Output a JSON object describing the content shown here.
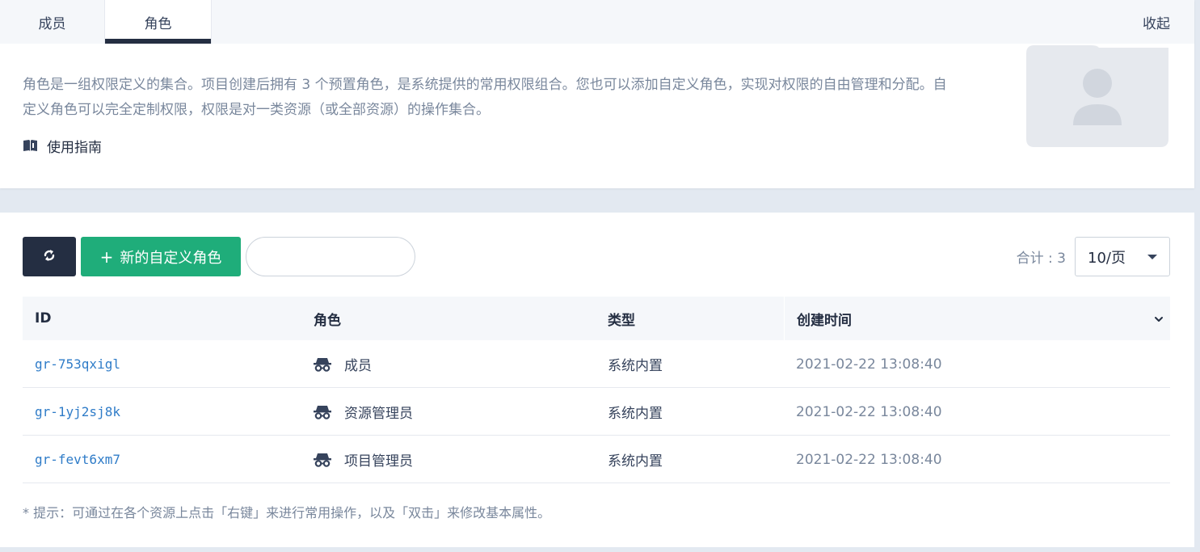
{
  "tabs": [
    {
      "label": "成员",
      "active": false
    },
    {
      "label": "角色",
      "active": true
    }
  ],
  "collapse_label": "收起",
  "description": "角色是一组权限定义的集合。项目创建后拥有 3 个预置角色，是系统提供的常用权限组合。您也可以添加自定义角色，实现对权限的自由管理和分配。自定义角色可以完全定制权限，权限是对一类资源（或全部资源）的操作集合。",
  "guide": {
    "label": "使用指南",
    "icon": "book-icon"
  },
  "toolbar": {
    "refresh_icon": "refresh-icon",
    "create_label": "新的自定义角色",
    "create_icon": "plus-icon",
    "search_placeholder": "",
    "total_label": "合计 : 3",
    "page_size": "10/页"
  },
  "table": {
    "columns": [
      "ID",
      "角色",
      "类型",
      "创建时间"
    ],
    "rows": [
      {
        "id": "gr-753qxigl",
        "role": "成员",
        "type": "系统内置",
        "created": "2021-02-22 13:08:40"
      },
      {
        "id": "gr-1yj2sj8k",
        "role": "资源管理员",
        "type": "系统内置",
        "created": "2021-02-22 13:08:40"
      },
      {
        "id": "gr-fevt6xm7",
        "role": "项目管理员",
        "type": "系统内置",
        "created": "2021-02-22 13:08:40"
      }
    ]
  },
  "hint": "* 提示：可通过在各个资源上点击「右键」来进行常用操作，以及「双击」来修改基本属性。",
  "colors": {
    "primary_dark": "#242e42",
    "success_green": "#1fad7a",
    "link_blue": "#2f7cc8",
    "muted_text": "#79879c",
    "page_bg": "#e3e9f1"
  }
}
